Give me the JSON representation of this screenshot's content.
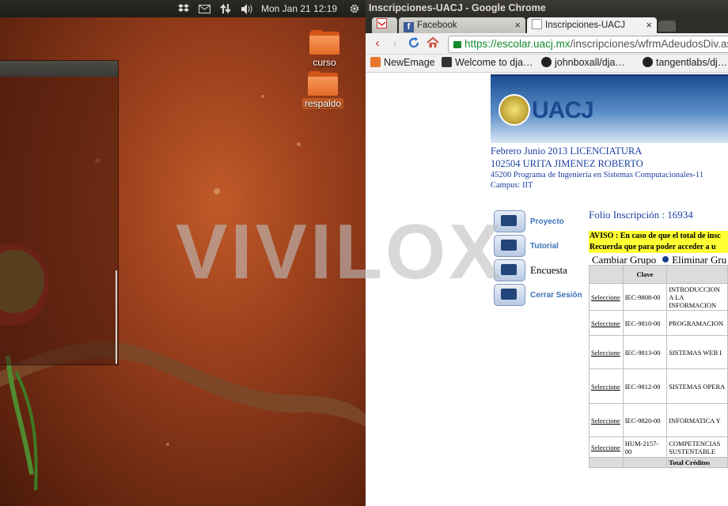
{
  "desktop": {
    "panel": {
      "clock": "Mon Jan 21  12:19",
      "indicators": [
        "dropbox-icon",
        "mail-icon",
        "network-icon",
        "volume-icon",
        "settings-gear-icon"
      ]
    },
    "icons": [
      {
        "label": "curso",
        "selected": false
      },
      {
        "label": "respaldo",
        "selected": true
      }
    ]
  },
  "browser": {
    "window_title": "Inscripciones-UACJ - Google Chrome",
    "tabs": [
      {
        "label": "",
        "icon": "gmail-icon",
        "active": false
      },
      {
        "label": "Facebook",
        "icon": "facebook-icon",
        "active": false
      },
      {
        "label": "Inscripciones-UACJ",
        "icon": "page-icon",
        "active": true
      }
    ],
    "url_scheme": "https://",
    "url_host": "escolar.uacj.mx",
    "url_path": "/inscripciones/wfrmAdeudosDiv.aspx",
    "bookmarks": [
      {
        "label": "NewEmage",
        "icon": "folder-icon"
      },
      {
        "label": "Welcome to dja…",
        "icon": "django-icon"
      },
      {
        "label": "johnboxall/dja…",
        "icon": "github-icon"
      },
      {
        "label": "tangentlabs/dj…",
        "icon": "github-icon"
      }
    ]
  },
  "page": {
    "logo_text": "UACJ",
    "period": "Febrero Junio 2013 LICENCIATURA",
    "student": "102504 URITA JIMENEZ ROBERTO",
    "program": "45200 Programa de Ingeniería en Sistemas Computacionales-11",
    "campus": "Campus: IIT",
    "menu": [
      {
        "label": "Proyecto",
        "icon": "project-icon"
      },
      {
        "label": "Tutorial",
        "icon": "tutorial-icon"
      },
      {
        "label": "Encuesta",
        "icon": "survey-icon"
      },
      {
        "label": "Cerrar Sesión",
        "icon": "logout-icon"
      }
    ],
    "folio": "Folio Inscripción : 16934",
    "aviso_line1": "AVISO : En caso de que el total de insc",
    "aviso_line2": "Recuerda que para poder acceder a u",
    "action_change": "Cambiar Grupo",
    "action_delete": "Eliminar Gru",
    "table": {
      "header_clave": "Clave",
      "rows": [
        {
          "link": "Seleccione",
          "clave": "IEC-9808-00",
          "materia": "INTRODUCCION A LA INFORMACION"
        },
        {
          "link": "Seleccione",
          "clave": "IEC-9810-00",
          "materia": "PROGRAMACION"
        },
        {
          "link": "Seleccione",
          "clave": "IEC-9813-00",
          "materia": "SISTEMAS WEB I"
        },
        {
          "link": "Seleccione",
          "clave": "IEC-9812-00",
          "materia": "SISTEMAS OPERA"
        },
        {
          "link": "Seleccione",
          "clave": "IEC-9820-00",
          "materia": "INFORMATICA Y"
        },
        {
          "link": "Seleccione",
          "clave": "HUM-2157-00",
          "materia": "COMPETENCIAS SUSTENTABLE"
        }
      ],
      "footer": "Total Créditos"
    }
  },
  "watermark": "VIVILOX"
}
